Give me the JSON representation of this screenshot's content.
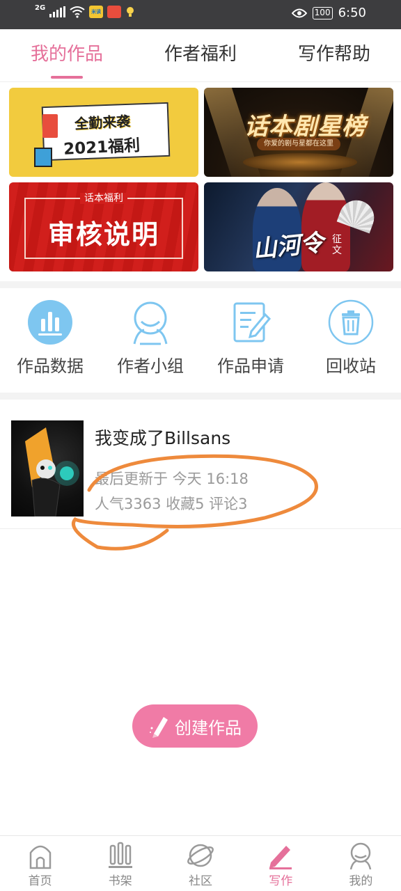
{
  "status_bar": {
    "network": "2G",
    "app_icon_1": "米读",
    "app_icon_2_color": "#e84d3d",
    "battery": "100",
    "time": "6:50"
  },
  "tabs": [
    {
      "label": "我的作品",
      "active": true
    },
    {
      "label": "作者福利",
      "active": false
    },
    {
      "label": "写作帮助",
      "active": false
    }
  ],
  "banners": {
    "attendance": {
      "line1": "全勤来袭",
      "line2": "2021福利"
    },
    "star_list": {
      "title": "话本剧星榜",
      "subtitle": "你爱的剧与星都在这里"
    },
    "review": {
      "small": "话本福利",
      "big": "审核说明"
    },
    "contest": {
      "title": "山河令",
      "tag": "征文"
    }
  },
  "actions": [
    {
      "label": "作品数据",
      "icon": "bar-chart-icon"
    },
    {
      "label": "作者小组",
      "icon": "group-icon"
    },
    {
      "label": "作品申请",
      "icon": "edit-document-icon"
    },
    {
      "label": "回收站",
      "icon": "trash-icon"
    }
  ],
  "work": {
    "title": "我变成了Billsans",
    "updated": "最后更新于 今天 16:18",
    "stats": "人气3363 收藏5 评论3"
  },
  "create_button": {
    "label": "创建作品",
    "icon": "pencil-icon"
  },
  "bottom_nav": [
    {
      "label": "首页",
      "icon": "home-icon",
      "active": false
    },
    {
      "label": "书架",
      "icon": "bookshelf-icon",
      "active": false
    },
    {
      "label": "社区",
      "icon": "planet-icon",
      "active": false
    },
    {
      "label": "写作",
      "icon": "pen-icon",
      "active": true
    },
    {
      "label": "我的",
      "icon": "profile-icon",
      "active": false
    }
  ],
  "colors": {
    "accent": "#e5709a",
    "button": "#f07ba6",
    "action_icon": "#7ec6f0",
    "annotation_circle": "#ee8a3c"
  }
}
